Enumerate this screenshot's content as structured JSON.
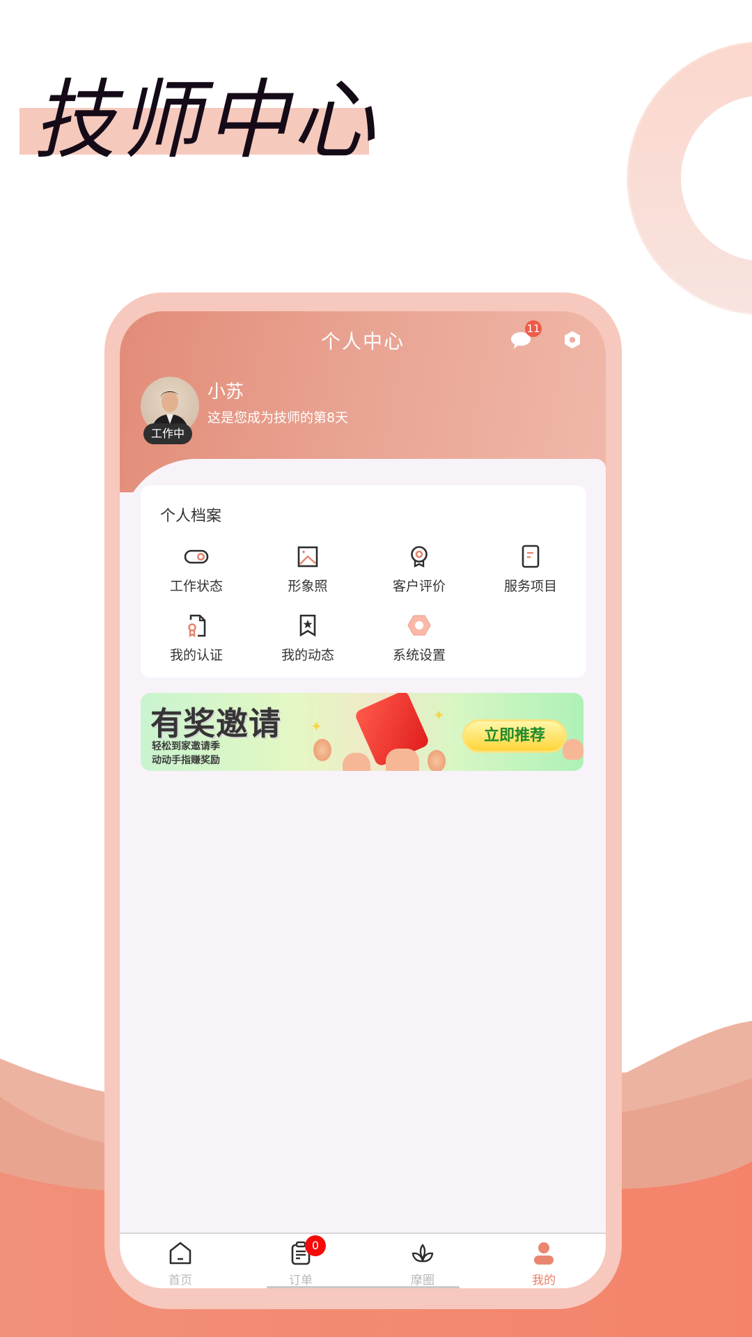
{
  "promo": {
    "title": "技师中心"
  },
  "colors": {
    "accent": "#e8806a",
    "header_start": "#e28c78",
    "header_end": "#f0b8a9",
    "phone_frame": "#f7c8bd",
    "badge_red": "#f50a0a"
  },
  "header": {
    "title": "个人中心",
    "message_badge": "11",
    "icons": [
      "chat-icon",
      "settings-icon"
    ]
  },
  "profile": {
    "name": "小苏",
    "subtitle": "这是您成为技师的第8天",
    "status_badge": "工作中"
  },
  "archive": {
    "title": "个人档案",
    "items": [
      {
        "label": "工作状态",
        "icon": "toggle-icon"
      },
      {
        "label": "形象照",
        "icon": "image-icon"
      },
      {
        "label": "客户评价",
        "icon": "award-icon"
      },
      {
        "label": "服务项目",
        "icon": "document-icon"
      },
      {
        "label": "我的认证",
        "icon": "certificate-icon"
      },
      {
        "label": "我的动态",
        "icon": "bookmark-star-icon"
      },
      {
        "label": "系统设置",
        "icon": "settings-icon"
      }
    ]
  },
  "banner": {
    "title": "有奖邀请",
    "line1": "轻松到家邀请季",
    "line2": "动动手指赚奖励",
    "button": "立即推荐"
  },
  "tabbar": {
    "items": [
      {
        "label": "首页",
        "icon": "home-icon",
        "active": false
      },
      {
        "label": "订单",
        "icon": "orders-icon",
        "active": false,
        "badge": "0"
      },
      {
        "label": "摩圈",
        "icon": "lotus-icon",
        "active": false
      },
      {
        "label": "我的",
        "icon": "user-icon",
        "active": true
      }
    ]
  }
}
